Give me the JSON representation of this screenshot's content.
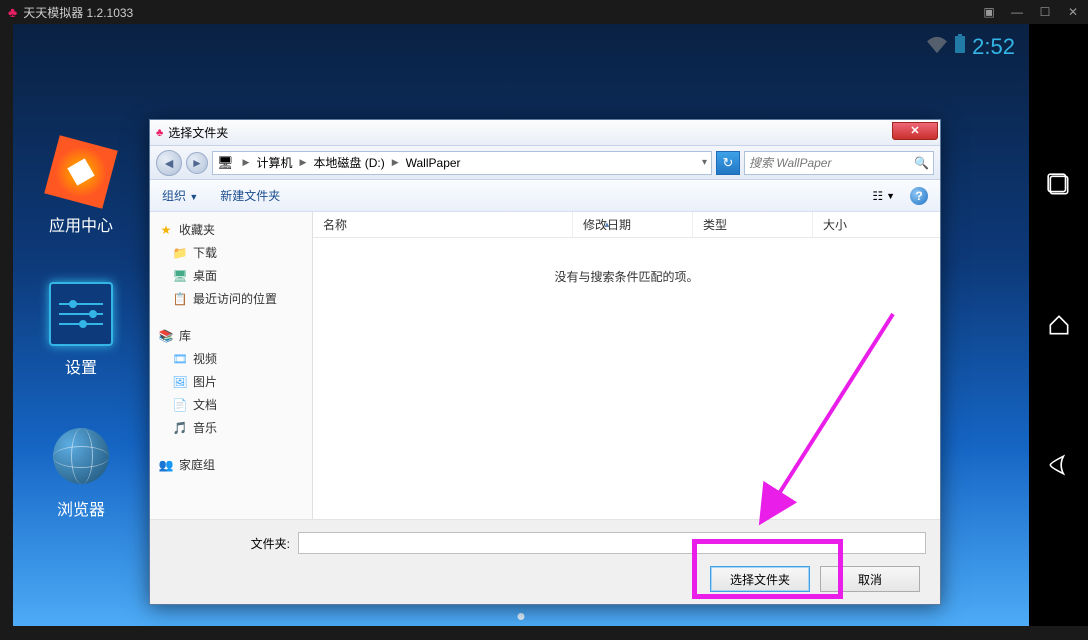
{
  "emulator": {
    "title": "天天模拟器 1.2.1033"
  },
  "android": {
    "clock": "2:52",
    "icons": {
      "app_center": "应用中心",
      "settings": "设置",
      "browser": "浏览器"
    }
  },
  "dialog": {
    "title": "选择文件夹",
    "breadcrumb": {
      "seg1": "计算机",
      "seg2": "本地磁盘 (D:)",
      "seg3": "WallPaper"
    },
    "search_placeholder": "搜索 WallPaper",
    "toolbar": {
      "organize": "组织",
      "new_folder": "新建文件夹"
    },
    "tree": {
      "favorites": "收藏夹",
      "downloads": "下载",
      "desktop": "桌面",
      "recent": "最近访问的位置",
      "libraries": "库",
      "videos": "视频",
      "pictures": "图片",
      "documents": "文档",
      "music": "音乐",
      "homegroup": "家庭组"
    },
    "columns": {
      "name": "名称",
      "date": "修改日期",
      "type": "类型",
      "size": "大小"
    },
    "empty_message": "没有与搜索条件匹配的项。",
    "folder_label": "文件夹:",
    "folder_value": "",
    "btn_select": "选择文件夹",
    "btn_cancel": "取消"
  }
}
